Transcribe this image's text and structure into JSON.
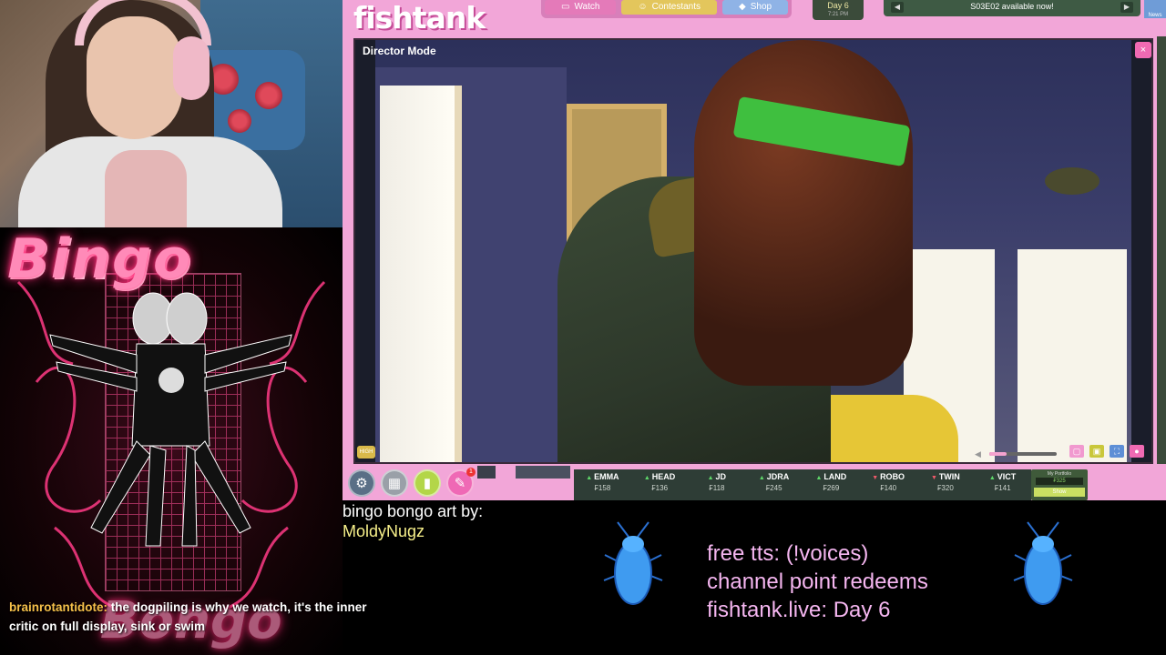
{
  "chat": {
    "username": "brainrotantidote",
    "message": "the dogpiling is why we watch, it's the inner critic on full display, sink or swim"
  },
  "bingo": {
    "title": "Bingo",
    "title_bottom": "Bongo"
  },
  "fishtank": {
    "logo": "fishtank",
    "nav": {
      "watch": "Watch",
      "contestants": "Contestants",
      "shop": "Shop"
    },
    "day": "Day 6",
    "day_time": "7:21 PM",
    "ticker": "S03E02 available now!",
    "news_label": "News",
    "video": {
      "mode_label": "Director Mode",
      "close": "×",
      "quality": "HIGH",
      "volume_fraction": 0.25
    },
    "stocks": [
      {
        "name": "EMMA",
        "price": "₣158",
        "trend": "up"
      },
      {
        "name": "HEAD",
        "price": "₣136",
        "trend": "up"
      },
      {
        "name": "JD",
        "price": "₣118",
        "trend": "up"
      },
      {
        "name": "JDRA",
        "price": "₣245",
        "trend": "up"
      },
      {
        "name": "LAND",
        "price": "₣269",
        "trend": "up"
      },
      {
        "name": "ROBO",
        "price": "₣140",
        "trend": "down"
      },
      {
        "name": "TWIN",
        "price": "₣320",
        "trend": "down"
      },
      {
        "name": "VICT",
        "price": "₣141",
        "trend": "up"
      }
    ],
    "portfolio": {
      "label": "My Portfolio",
      "value": "₣325",
      "show": "Show"
    },
    "tool_badge": "1"
  },
  "overlay": {
    "art_credit_line": "bingo bongo art by:",
    "art_artist": "MoldyNugz",
    "info_lines": [
      "free tts: (!voices)",
      "channel point redeems",
      "fishtank.live: Day 6"
    ]
  },
  "colors": {
    "fishtank_pink": "#f2a6d8",
    "neon_pink": "#ff2e7a",
    "chat_user": "#f5c04a",
    "info_text": "#f5b6f0",
    "stock_up": "#5fd86a",
    "stock_down": "#ef5a6a"
  }
}
